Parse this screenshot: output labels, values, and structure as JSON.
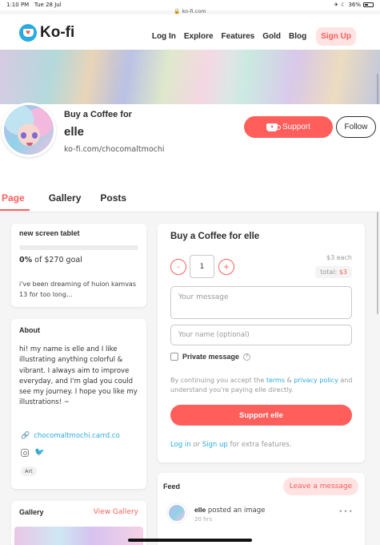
{
  "status_bar": {
    "time": "1:10 PM",
    "date": "Tue 28 Jul",
    "url": "ko-fi.com",
    "battery": "36%"
  },
  "header": {
    "logo_text": "Ko-fi",
    "nav": [
      "Log In",
      "Explore",
      "Features",
      "Gold",
      "Blog"
    ],
    "signup": "Sign Up"
  },
  "profile": {
    "buy_label": "Buy a Coffee for",
    "name": "elle",
    "url": "ko-fi.com/chocomaltmochi",
    "support_button": "Support",
    "follow_button": "Follow"
  },
  "tabs": [
    "Page",
    "Gallery",
    "Posts"
  ],
  "goal": {
    "title": "new screen tablet",
    "percent": "0%",
    "progress_fraction": 0,
    "of_text": "of $270 goal",
    "description": "i've been dreaming of huion kamvas 13 for too long..."
  },
  "about": {
    "title": "About",
    "text": "hi! my name is elle and I like illustrating anything colorful & vibrant. I always aim to improve everyday, and I'm glad you could see my journey. I hope you like my illustrations! ~",
    "link": "chocomaltmochi.carrd.co",
    "tag": "Art"
  },
  "gallery": {
    "title": "Gallery",
    "view_link": "View Gallery"
  },
  "buy_card": {
    "title": "Buy a Coffee for elle",
    "minus": "-",
    "plus": "+",
    "quantity": "1",
    "each": "$3 each",
    "total_label": "total:",
    "total_value": "$3",
    "message_placeholder": "Your message",
    "name_placeholder": "Your name (optional)",
    "private_label": "Private message",
    "terms": {
      "part1": "By continuing you accept the ",
      "terms_link": "terms",
      "part2": " & ",
      "privacy_link": "privacy policy",
      "part3": " and understand you're paying elle directly."
    },
    "support_button": "Support elle",
    "login": {
      "login_link": "Log in",
      "or": " or ",
      "signup_link": "Sign up",
      "rest": " for extra features."
    }
  },
  "feed": {
    "title": "Feed",
    "leave_button": "Leave a message",
    "item": {
      "user": "elle",
      "action": " posted an image",
      "time": "20 hrs"
    }
  },
  "colors": {
    "accent": "#ff5e5b",
    "link": "#29abe0",
    "logo_blue": "#29abe0"
  }
}
